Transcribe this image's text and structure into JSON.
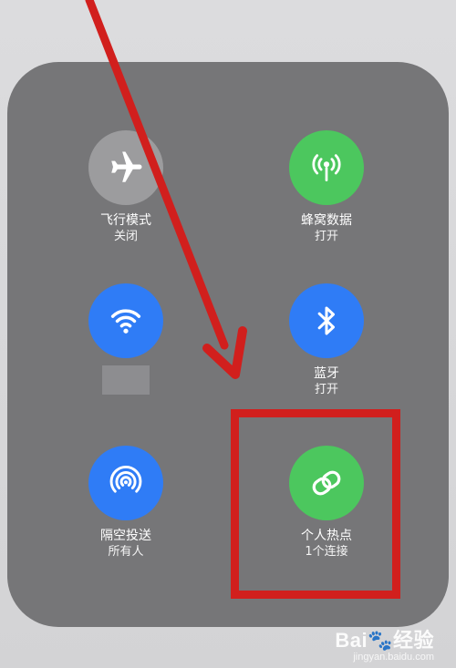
{
  "colors": {
    "panel": "#767678",
    "inactive": "#9c9c9e",
    "green": "#4cc75e",
    "blue": "#2f7cf6",
    "annotation_red": "#d11f1d"
  },
  "controls": {
    "airplane": {
      "icon": "airplane-icon",
      "label": "飞行模式",
      "status": "关闭"
    },
    "cellular": {
      "icon": "antenna-icon",
      "label": "蜂窝数据",
      "status": "打开"
    },
    "wifi": {
      "icon": "wifi-icon",
      "label": "",
      "status": ""
    },
    "bluetooth": {
      "icon": "bluetooth-icon",
      "label": "蓝牙",
      "status": "打开"
    },
    "airdrop": {
      "icon": "airdrop-icon",
      "label": "隔空投送",
      "status": "所有人"
    },
    "hotspot": {
      "icon": "hotspot-link-icon",
      "label": "个人热点",
      "status": "1个连接"
    }
  },
  "watermark": {
    "main": "Bai🐾经验",
    "sub": "jingyan.baidu.com"
  }
}
